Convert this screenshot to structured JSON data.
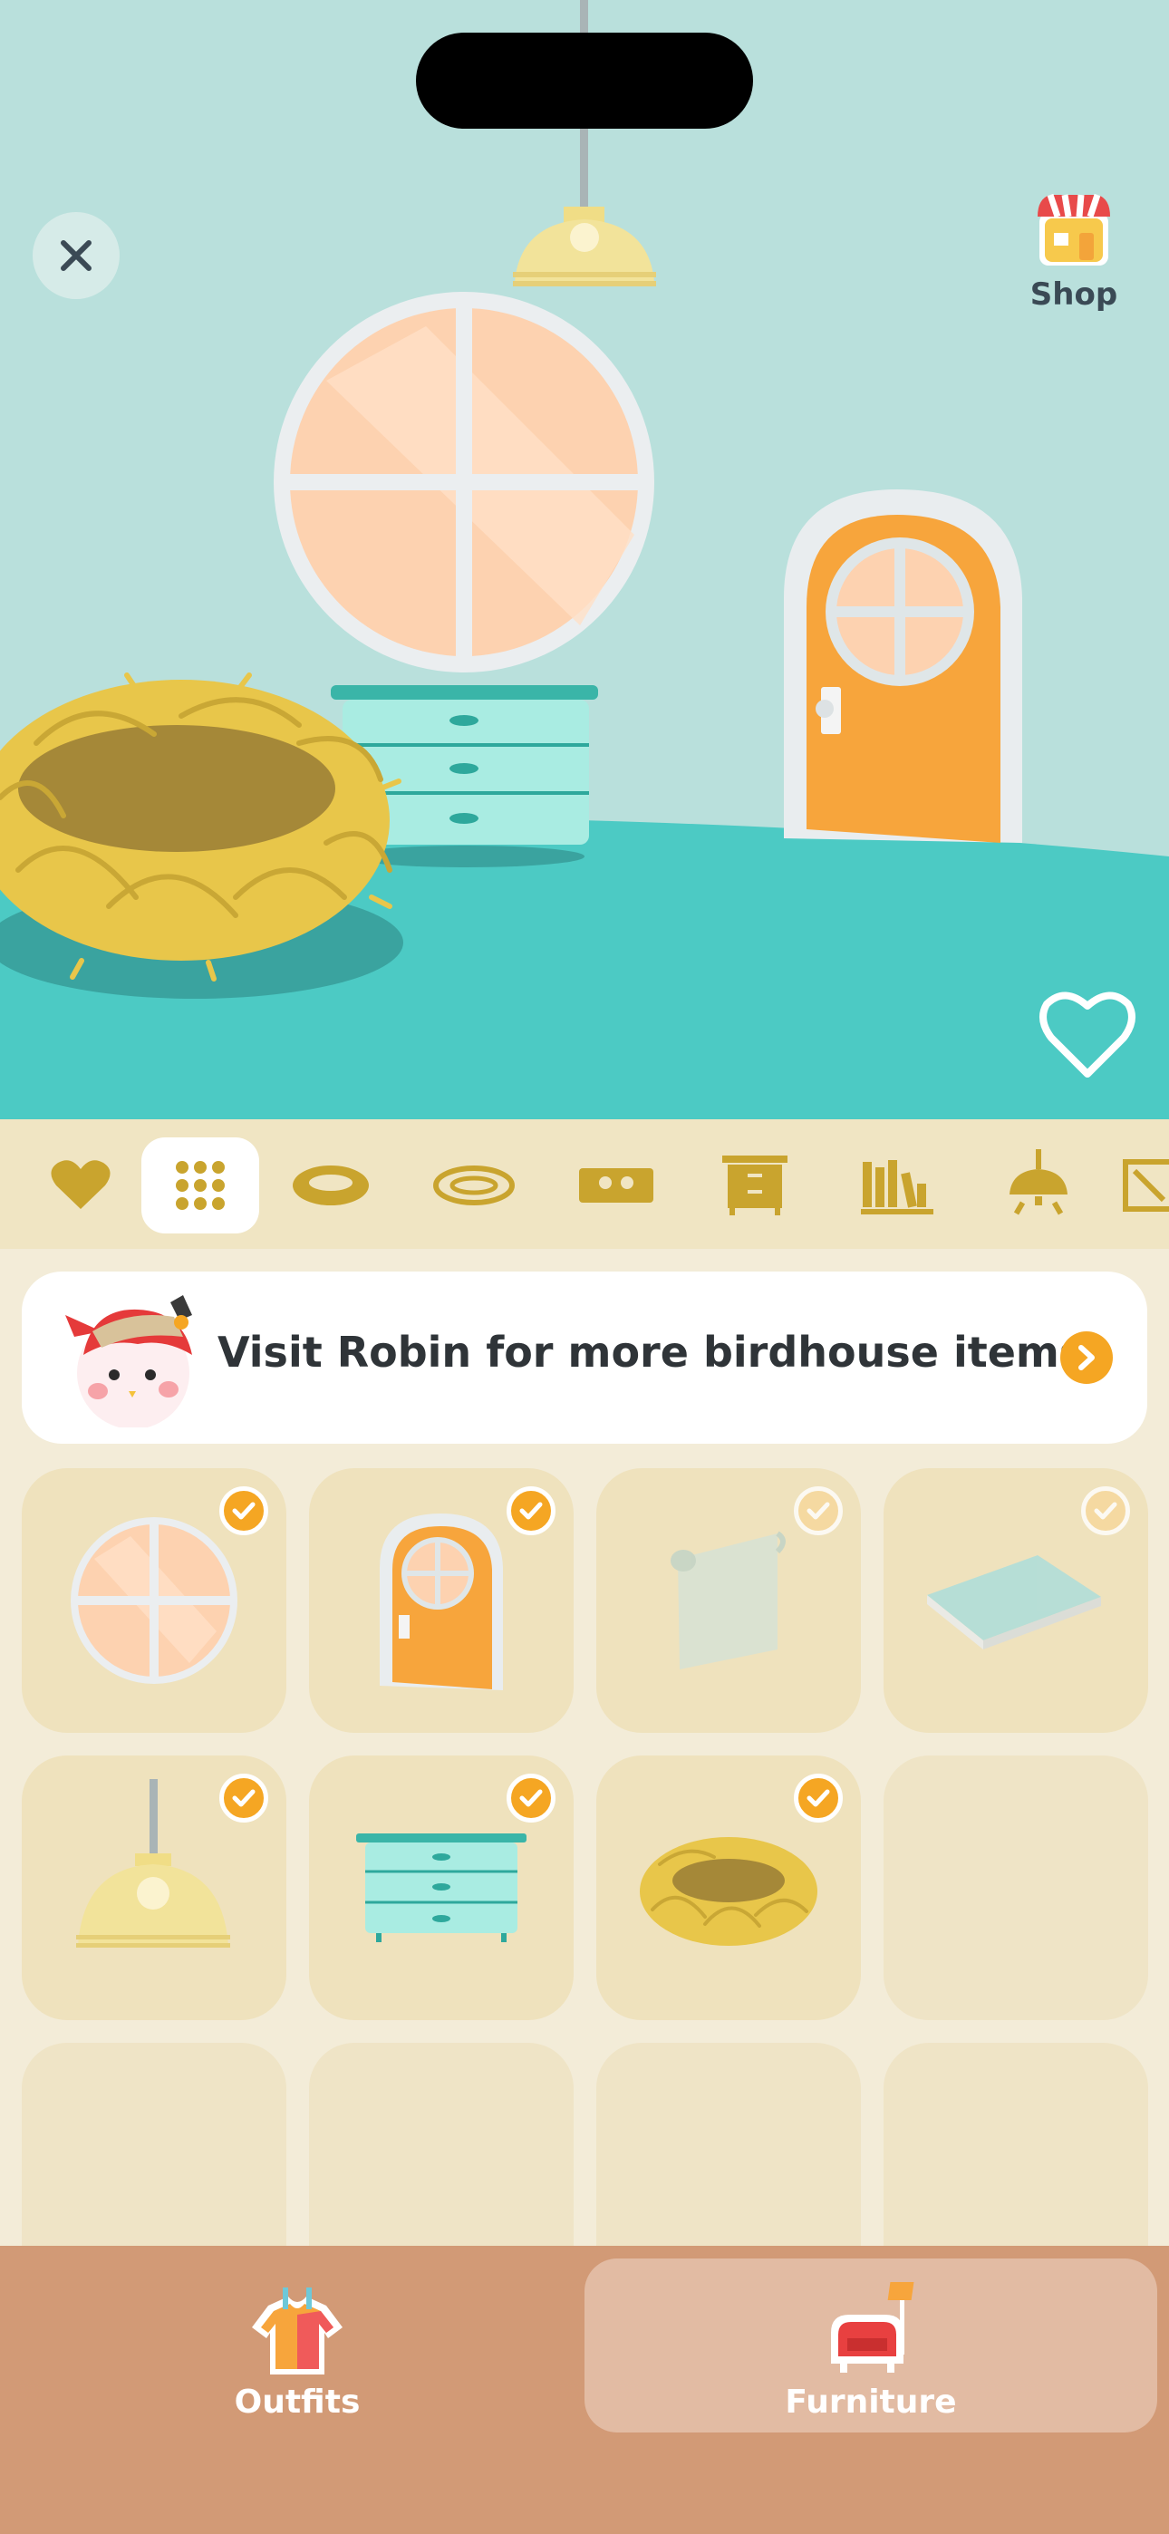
{
  "scene": {
    "shop_label": "Shop"
  },
  "categories": [
    {
      "icon": "heart-icon",
      "active": false
    },
    {
      "icon": "grid-icon",
      "active": true
    },
    {
      "icon": "nest-icon",
      "active": false
    },
    {
      "icon": "rug-icon",
      "active": false
    },
    {
      "icon": "mat-icon",
      "active": false
    },
    {
      "icon": "dresser-icon",
      "active": false
    },
    {
      "icon": "bookshelf-icon",
      "active": false
    },
    {
      "icon": "ceiling-lamp-icon",
      "active": false
    },
    {
      "icon": "wall-art-icon",
      "active": false
    }
  ],
  "banner": {
    "text": "Visit Robin for more birdhouse items!",
    "avatar": "robin-avatar"
  },
  "items": [
    {
      "name": "round-window",
      "owned": true,
      "active": true
    },
    {
      "name": "arched-door",
      "owned": true,
      "active": true
    },
    {
      "name": "wallpaper",
      "owned": true,
      "active": false
    },
    {
      "name": "floor",
      "owned": true,
      "active": false
    },
    {
      "name": "pendant-lamp",
      "owned": true,
      "active": true
    },
    {
      "name": "dresser",
      "owned": true,
      "active": true
    },
    {
      "name": "straw-nest",
      "owned": true,
      "active": true
    }
  ],
  "tabs": {
    "outfits": "Outfits",
    "furniture": "Furniture",
    "active": "furniture"
  },
  "colors": {
    "accent": "#f5a623",
    "wall": "#b9e0dc",
    "floor": "#4ccac4",
    "tabbar": "#d29a76"
  }
}
